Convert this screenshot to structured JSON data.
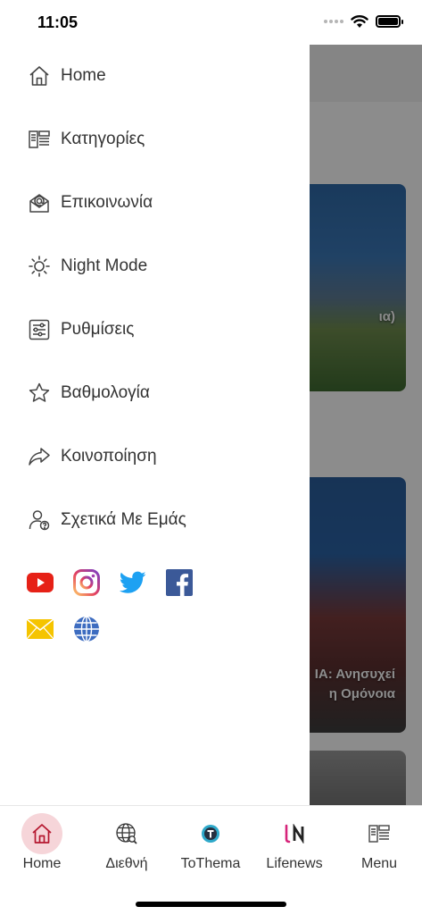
{
  "status": {
    "time": "11:05"
  },
  "background": {
    "card1_caption": "ια)",
    "card2_caption_line1": "ΙΑ: Ανησυχεί",
    "card2_caption_line2": "η Ομόνοια"
  },
  "drawer": {
    "items": [
      {
        "label": "Home",
        "icon": "home-icon"
      },
      {
        "label": "Κατηγορίες",
        "icon": "categories-icon"
      },
      {
        "label": "Επικοινωνία",
        "icon": "contact-mail-icon"
      },
      {
        "label": "Night Mode",
        "icon": "sun-icon"
      },
      {
        "label": "Ρυθμίσεις",
        "icon": "sliders-icon"
      },
      {
        "label": "Βαθμολογία",
        "icon": "star-icon"
      },
      {
        "label": "Κοινοποίηση",
        "icon": "share-icon"
      },
      {
        "label": "Σχετικά Με Εμάς",
        "icon": "about-user-icon"
      }
    ],
    "social": [
      "youtube-icon",
      "instagram-icon",
      "twitter-icon",
      "facebook-icon",
      "email-icon",
      "globe-icon"
    ]
  },
  "tabbar": {
    "tabs": [
      {
        "label": "Home",
        "active": true
      },
      {
        "label": "Διεθνή",
        "active": false
      },
      {
        "label": "ToThema",
        "active": false
      },
      {
        "label": "Lifenews",
        "active": false
      },
      {
        "label": "Menu",
        "active": false
      }
    ]
  },
  "colors": {
    "accent": "#b5172f",
    "active_tab_bg": "#f6d5d9",
    "youtube": "#e62117",
    "twitter": "#1da1f2",
    "facebook": "#3b5998",
    "email": "#f5c400",
    "globe": "#3d6cc0"
  }
}
